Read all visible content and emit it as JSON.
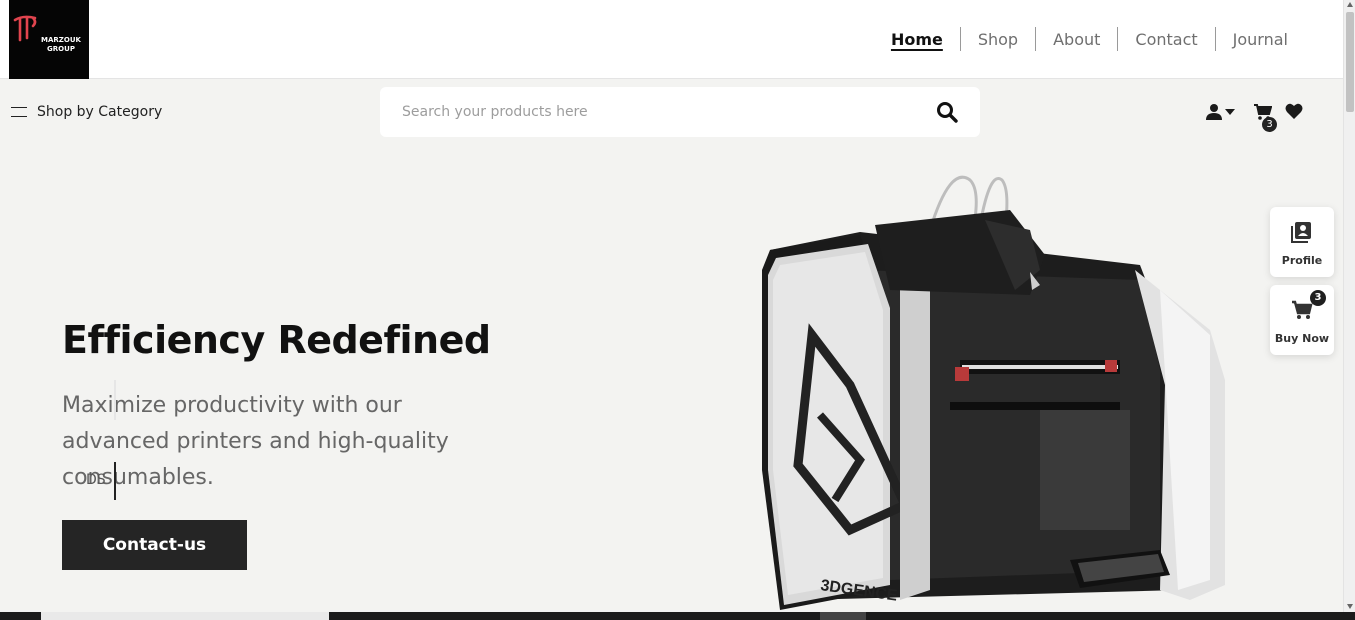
{
  "brand": {
    "logo_text": "MARZOUK GROUP"
  },
  "nav": {
    "items": [
      {
        "label": "Home",
        "active": true
      },
      {
        "label": "Shop",
        "active": false
      },
      {
        "label": "About",
        "active": false
      },
      {
        "label": "Contact",
        "active": false
      },
      {
        "label": "Journal",
        "active": false
      }
    ]
  },
  "toolbar": {
    "category_label": "Shop by Category",
    "search_placeholder": "Search your products here",
    "cart_count": "3"
  },
  "hero": {
    "title": "Efficiency Redefined",
    "subtitle": "Maximize productivity with our advanced printers and high-quality consumables.",
    "ghost_text": "DS",
    "cta_label": "Contact-us",
    "product_brand": "3DGENCE"
  },
  "floating": {
    "profile_label": "Profile",
    "buy_label": "Buy Now",
    "buy_count": "3"
  },
  "colors": {
    "accent": "#252525",
    "logo_red": "#e0444e",
    "hero_bg": "#f3f3f1"
  },
  "icons": [
    "menu-icon",
    "search-icon",
    "user-icon",
    "caret-down-icon",
    "cart-icon",
    "heart-icon",
    "profile-icon",
    "cart-icon"
  ]
}
